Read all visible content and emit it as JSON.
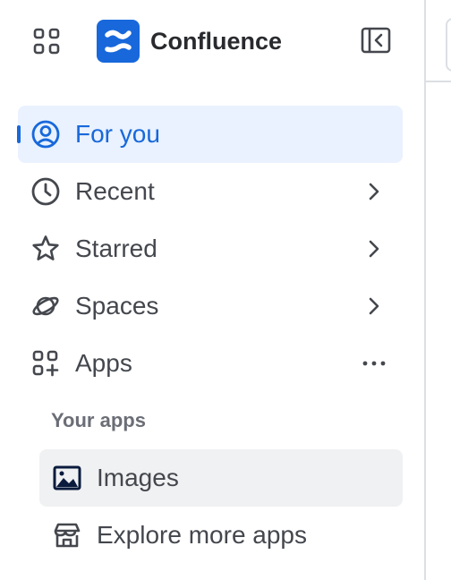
{
  "header": {
    "product_name": "Confluence"
  },
  "nav": {
    "items": [
      {
        "label": "For you",
        "icon": "person-circle-icon",
        "selected": true
      },
      {
        "label": "Recent",
        "icon": "clock-icon",
        "expandable": true
      },
      {
        "label": "Starred",
        "icon": "star-icon",
        "expandable": true
      },
      {
        "label": "Spaces",
        "icon": "planet-icon",
        "expandable": true
      },
      {
        "label": "Apps",
        "icon": "apps-add-icon",
        "more_actions": true
      }
    ]
  },
  "apps_section": {
    "heading": "Your apps",
    "items": [
      {
        "label": "Images",
        "icon": "image-icon"
      },
      {
        "label": "Explore more apps",
        "icon": "store-icon"
      }
    ]
  },
  "colors": {
    "accent": "#1868db",
    "selected_bg": "#e9f2fe",
    "hover_bg": "#f0f1f2",
    "text": "#44474d",
    "muted": "#6b6e76"
  }
}
